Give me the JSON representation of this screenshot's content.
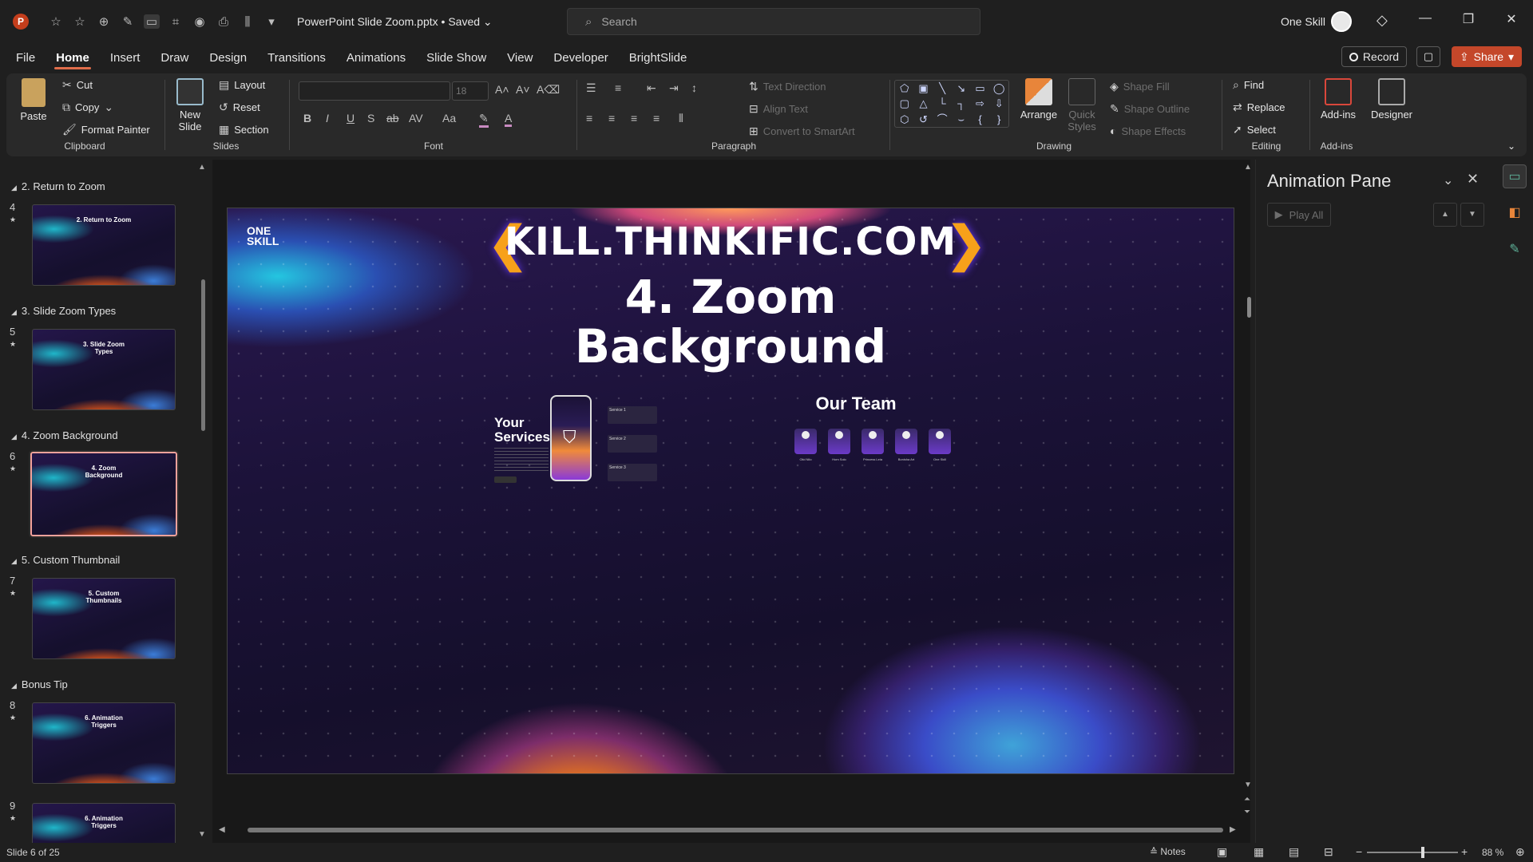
{
  "titlebar": {
    "app_icon": "P",
    "doc_title": "PowerPoint Slide Zoom.pptx • Saved ⌄",
    "search_placeholder": "Search",
    "user_name": "One Skill"
  },
  "tabs": [
    "File",
    "Home",
    "Insert",
    "Draw",
    "Design",
    "Transitions",
    "Animations",
    "Slide Show",
    "View",
    "Developer",
    "BrightSlide"
  ],
  "active_tab": "Home",
  "actions": {
    "record": "Record",
    "share": "Share"
  },
  "ribbon": {
    "clipboard": {
      "label": "Clipboard",
      "paste": "Paste",
      "cut": "Cut",
      "copy": "Copy",
      "format_painter": "Format Painter"
    },
    "slides": {
      "label": "Slides",
      "new_slide": "New Slide",
      "layout": "Layout",
      "reset": "Reset",
      "section": "Section"
    },
    "font": {
      "label": "Font",
      "font_size": "18"
    },
    "paragraph": {
      "label": "Paragraph",
      "text_direction": "Text Direction",
      "align_text": "Align Text",
      "convert_smartart": "Convert to SmartArt"
    },
    "drawing": {
      "label": "Drawing",
      "arrange": "Arrange",
      "quick_styles": "Quick Styles",
      "shape_fill": "Shape Fill",
      "shape_outline": "Shape Outline",
      "shape_effects": "Shape Effects"
    },
    "editing": {
      "label": "Editing",
      "find": "Find",
      "replace": "Replace",
      "select": "Select"
    },
    "addins": {
      "label": "Add-ins",
      "addins_btn": "Add-ins",
      "designer": "Designer"
    }
  },
  "thumbnails": {
    "sections": [
      {
        "name": "2. Return to Zoom",
        "slide_number": "4",
        "thumb_title": "2. Return to Zoom"
      },
      {
        "name": "3. Slide Zoom Types",
        "slide_number": "5",
        "thumb_title": "3. Slide Zoom Types"
      },
      {
        "name": "4. Zoom Background",
        "slide_number": "6",
        "thumb_title": "4. Zoom Background"
      },
      {
        "name": "5. Custom Thumbnail",
        "slide_number": "7",
        "thumb_title": "5. Custom Thumbnails"
      },
      {
        "name": "Bonus Tip",
        "slide_number": "8",
        "thumb_title": "6. Animation Triggers"
      },
      {
        "name": "",
        "slide_number": "9",
        "thumb_title": "6. Animation Triggers"
      }
    ],
    "selected_slide": "6"
  },
  "slide": {
    "url": "KILL.THINKIFIC.COM",
    "title_line1": "4. Zoom",
    "title_line2": "Background",
    "logo_line1": "ONE",
    "logo_line2": "SKILL",
    "services_heading_1": "Your",
    "services_heading_2": "Services",
    "service_cards": [
      "Service 1",
      "Service 2",
      "Service 3"
    ],
    "team_heading": "Our Team",
    "team_members": [
      "Olid Nilo",
      "Hom Solo",
      "Princess Leia",
      "Bonisha Art",
      "One Skill"
    ]
  },
  "animation_pane": {
    "title": "Animation Pane",
    "play_all": "Play All"
  },
  "status": {
    "slide_counter": "Slide 6 of 25",
    "notes": "Notes",
    "zoom": "88 %",
    "zoom_fraction": 0.6
  },
  "colors": {
    "accent": "#e06d4b",
    "share_bg": "#c4472a",
    "selected_thumb_border": "#f4a29b"
  }
}
